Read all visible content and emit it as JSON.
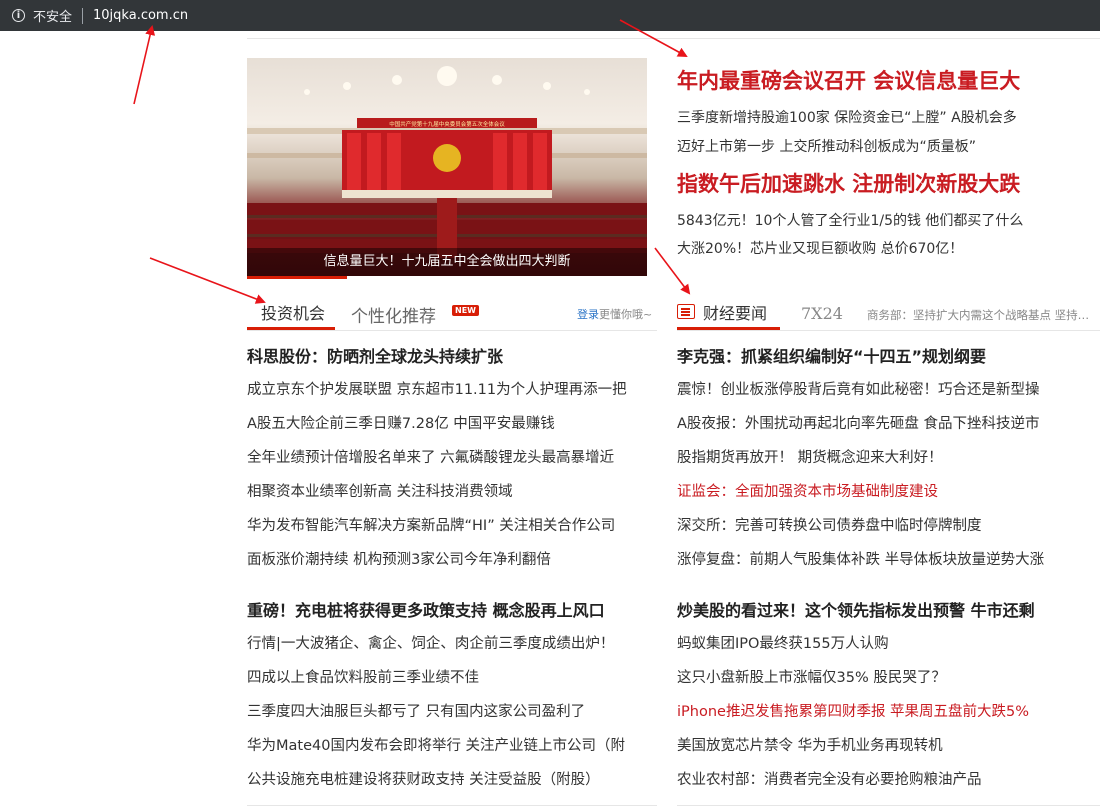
{
  "browser": {
    "security_label": "不安全",
    "url": "10jqka.com.cn",
    "info_icon": "info-icon"
  },
  "hero": {
    "caption": "信息量巨大！十九届五中全会做出四大判断",
    "banner_text": "中国共产党第十九届中央委员会第五次全体会议"
  },
  "top_news": {
    "headline1": "年内最重磅会议召开 会议信息量巨大",
    "sub1a": "三季度新增持股逾100家 保险资金已“上膛” A股机会多",
    "sub1b": "迈好上市第一步 上交所推动科创板成为“质量板”",
    "headline2": "指数午后加速跳水 注册制次新股大跌",
    "sub2a": "5843亿元！10个人管了全行业1/5的钱 他们都买了什么",
    "sub2b": "大涨20%！芯片业又现巨额收购 总价670亿！"
  },
  "left_tabs": {
    "active": "投资机会",
    "second": "个性化推荐",
    "new_badge": "NEW",
    "login_text": "登录",
    "login_suffix": "更懂你哦~"
  },
  "right_tabs": {
    "active": "财经要闻",
    "second": "7X24",
    "ticker": "商务部：坚持扩大内需这个战略基点 坚持实施更大范围、更宽领域、更深层次对外开放"
  },
  "left_list": {
    "title1": "科思股份：防晒剂全球龙头持续扩张",
    "items1": [
      "成立京东个护发展联盟 京东超市11.11为个人护理再添一把",
      "A股五大险企前三季日赚7.28亿 中国平安最赚钱",
      "全年业绩预计倍增股名单来了 六氟磷酸锂龙头最高暴增近",
      "相聚资本业绩率创新高 关注科技消费领域",
      "华为发布智能汽车解决方案新品牌“HI” 关注相关合作公司",
      "面板涨价潮持续 机构预测3家公司今年净利翻倍"
    ],
    "title2": "重磅！充电桩将获得更多政策支持 概念股再上风口",
    "items2": [
      "行情|一大波猪企、禽企、饲企、肉企前三季度成绩出炉！",
      "四成以上食品饮料股前三季业绩不佳",
      "三季度四大油服巨头都亏了 只有国内这家公司盈利了",
      "华为Mate40国内发布会即将举行 关注产业链上市公司（附",
      "公共设施充电桩建设将获财政支持 关注受益股（附股）"
    ]
  },
  "right_list": {
    "title1": "李克强：抓紧组织编制好“十四五”规划纲要",
    "items1": [
      "震惊！创业板涨停股背后竟有如此秘密！巧合还是新型操",
      "A股夜报：外围扰动再起北向率先砸盘 食品下挫科技逆市",
      "股指期货再放开！ 期货概念迎来大利好！",
      "证监会：全面加强资本市场基础制度建设",
      "深交所：完善可转换公司债券盘中临时停牌制度",
      "涨停复盘：前期人气股集体补跌 半导体板块放量逆势大涨"
    ],
    "title2": "炒美股的看过来！这个领先指标发出预警 牛市还剩",
    "items2": [
      "蚂蚁集团IPO最终获155万人认购",
      "这只小盘新股上市涨幅仅35% 股民哭了？",
      "iPhone推迟发售拖累第四财季报 苹果周五盘前大跌5%",
      "美国放宽芯片禁令 华为手机业务再现转机",
      "农业农村部：消费者完全没有必要抢购粮油产品"
    ]
  },
  "colors": {
    "accent_red": "#d81e06",
    "headline_red": "#c91c22",
    "link_blue": "#2b74c7",
    "annotation_arrow": "#e8141a"
  }
}
